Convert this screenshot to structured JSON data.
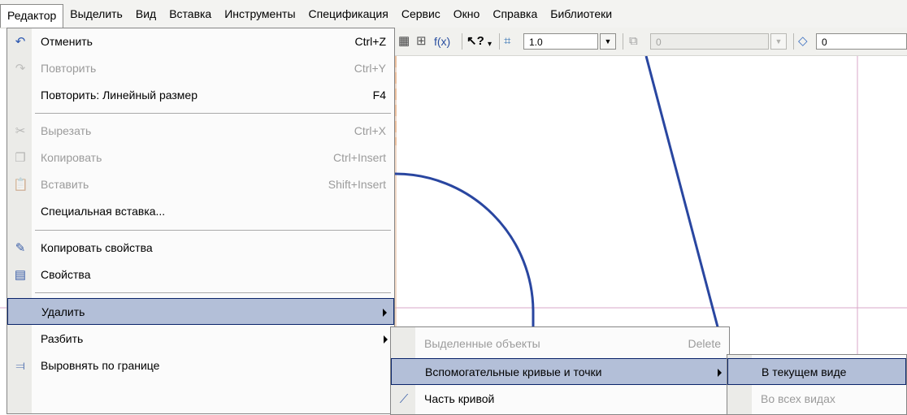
{
  "menubar": {
    "items": [
      "Редактор",
      "Выделить",
      "Вид",
      "Вставка",
      "Инструменты",
      "Спецификация",
      "Сервис",
      "Окно",
      "Справка",
      "Библиотеки"
    ]
  },
  "toolbar": {
    "fx_label": "f(x)",
    "help_label": "?",
    "scale_value": "1.0",
    "step_value": "0",
    "layer_value": "0"
  },
  "editor_menu": {
    "items": [
      {
        "label": "Отменить",
        "shortcut": "Ctrl+Z",
        "icon": "undo-icon"
      },
      {
        "label": "Повторить",
        "shortcut": "Ctrl+Y",
        "icon": "redo-icon"
      },
      {
        "label": "Повторить: Линейный размер",
        "shortcut": "F4"
      },
      {
        "label": "Вырезать",
        "shortcut": "Ctrl+X",
        "icon": "scissors-icon"
      },
      {
        "label": "Копировать",
        "shortcut": "Ctrl+Insert",
        "icon": "copy-icon"
      },
      {
        "label": "Вставить",
        "shortcut": "Shift+Insert",
        "icon": "paste-icon"
      },
      {
        "label": "Специальная вставка..."
      },
      {
        "label": "Копировать свойства",
        "icon": "brush-icon"
      },
      {
        "label": "Свойства",
        "icon": "properties-icon"
      },
      {
        "label": "Удалить"
      },
      {
        "label": "Разбить"
      },
      {
        "label": "Выровнять по границе",
        "icon": "align-icon"
      }
    ]
  },
  "delete_submenu": {
    "items": [
      {
        "label": "Выделенные объекты",
        "shortcut": "Delete"
      },
      {
        "label": "Вспомогательные кривые и точки"
      },
      {
        "label": "Часть кривой",
        "icon": "curve-part-icon"
      }
    ]
  },
  "aux_submenu": {
    "items": [
      {
        "label": "В текущем виде"
      },
      {
        "label": "Во всех видах"
      }
    ]
  }
}
